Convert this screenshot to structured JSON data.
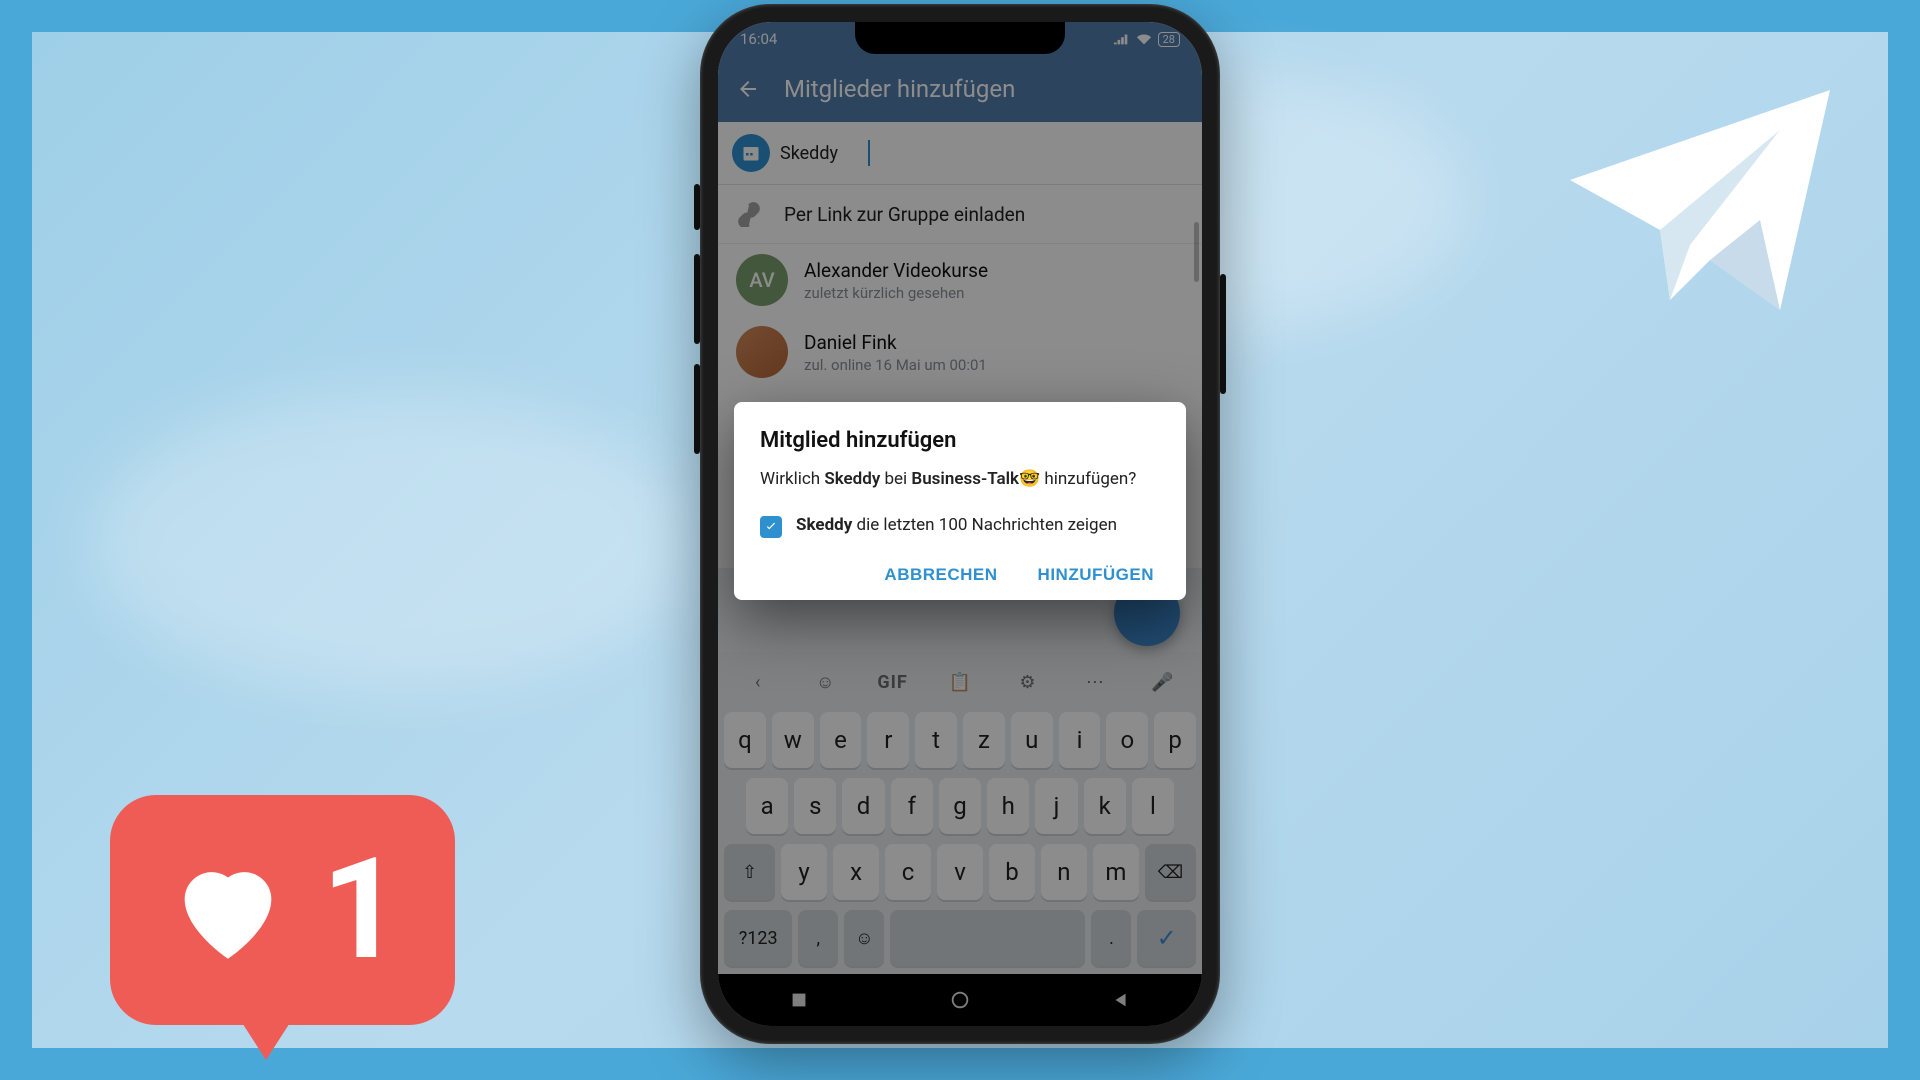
{
  "statusbar": {
    "time": "16:04",
    "battery": "28"
  },
  "appbar": {
    "title": "Mitglieder hinzufügen"
  },
  "chip": {
    "name": "Skeddy"
  },
  "linkrow": {
    "label": "Per Link zur Gruppe einladen"
  },
  "contacts": [
    {
      "avatar_initials": "AV",
      "name": "Alexander Videokurse",
      "status": "zuletzt kürzlich gesehen"
    },
    {
      "avatar_initials": "",
      "name": "Daniel Fink",
      "status": "zul. online 16 Mai um 00:01"
    }
  ],
  "dialog": {
    "title": "Mitglied hinzufügen",
    "body_prefix": "Wirklich ",
    "body_bold1": "Skeddy",
    "body_mid": " bei ",
    "body_bold2": "Business-Talk",
    "body_emoji": "🤓",
    "body_suffix": " hinzufügen?",
    "check_bold": "Skeddy",
    "check_rest": " die letzten 100 Nachrichten zeigen",
    "cancel": "ABBRECHEN",
    "confirm": "HINZUFÜGEN"
  },
  "keyboard": {
    "tools": {
      "gif": "GIF"
    },
    "row1": [
      "q",
      "w",
      "e",
      "r",
      "t",
      "z",
      "u",
      "i",
      "o",
      "p"
    ],
    "row2": [
      "a",
      "s",
      "d",
      "f",
      "g",
      "h",
      "j",
      "k",
      "l"
    ],
    "row3": [
      "y",
      "x",
      "c",
      "v",
      "b",
      "n",
      "m"
    ],
    "numkey": "?123"
  },
  "like": {
    "count": "1"
  }
}
